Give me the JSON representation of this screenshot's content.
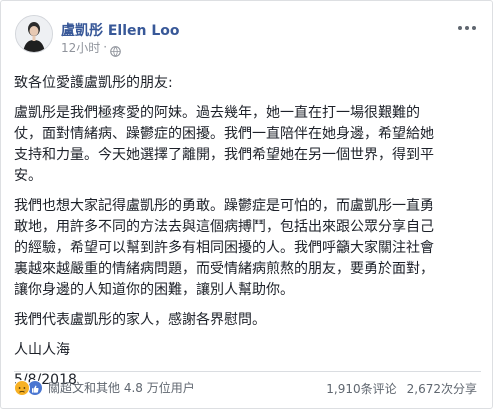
{
  "post": {
    "author": "盧凱彤 Ellen Loo",
    "timestamp": "12小时",
    "separator": "·",
    "privacy_icon": "globe-icon",
    "more_icon": "more-options-icon",
    "paragraphs": [
      "致各位愛護盧凱彤的朋友:",
      "盧凱彤是我們極疼愛的阿妹。過去幾年，她一直在打一場很艱難的\n仗，面對情緒病、躁鬱症的困擾。我們一直陪伴在她身邊，希望給她\n支持和力量。今天她選擇了離開，我們希望她在另一個世界，得到平\n安。",
      "我們也想大家記得盧凱彤的勇敢。躁鬱症是可怕的，而盧凱彤一直勇\n敢地，用許多不同的方法去與這個病搏鬥，包括出來跟公眾分享自己\n的經驗，希望可以幫到許多有相同困擾的人。我們呼籲大家關注社會\n裏越來越嚴重的情緒病問題，而受情緒病煎熬的朋友，要勇於面對，\n讓你身邊的人知道你的困難，讓別人幫助你。",
      "我們代表盧凱彤的家人，感謝各界慰問。",
      "人山人海",
      "5/8/2018"
    ],
    "reactions": {
      "icons": [
        "sad-icon",
        "like-icon"
      ],
      "text": "關超文和其他 4.8 万位用户"
    },
    "comments": "1,910条评论",
    "shares": "2,672次分享",
    "colors": {
      "author": "#385898",
      "meta": "#90949c",
      "sad": "#f7b125",
      "like": "#4a76d1"
    }
  }
}
